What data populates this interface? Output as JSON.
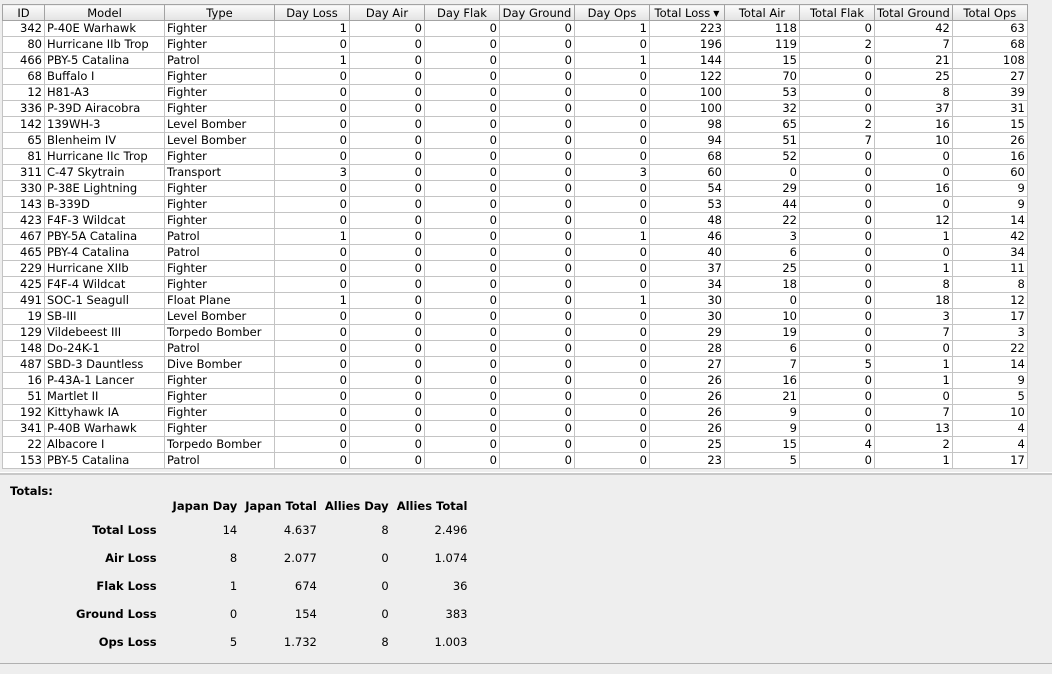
{
  "table": {
    "columns": [
      "ID",
      "Model",
      "Type",
      "Day Loss",
      "Day Air",
      "Day Flak",
      "Day Ground",
      "Day Ops",
      "Total Loss",
      "Total Air",
      "Total Flak",
      "Total Ground",
      "Total Ops"
    ],
    "sort": {
      "column": "Total Loss",
      "direction": "descending",
      "icon": "sort-descending-icon"
    },
    "rows": [
      [
        "342",
        "P-40E Warhawk",
        "Fighter",
        "1",
        "0",
        "0",
        "0",
        "1",
        "223",
        "118",
        "0",
        "42",
        "63"
      ],
      [
        "80",
        "Hurricane IIb Trop",
        "Fighter",
        "0",
        "0",
        "0",
        "0",
        "0",
        "196",
        "119",
        "2",
        "7",
        "68"
      ],
      [
        "466",
        "PBY-5 Catalina",
        "Patrol",
        "1",
        "0",
        "0",
        "0",
        "1",
        "144",
        "15",
        "0",
        "21",
        "108"
      ],
      [
        "68",
        "Buffalo I",
        "Fighter",
        "0",
        "0",
        "0",
        "0",
        "0",
        "122",
        "70",
        "0",
        "25",
        "27"
      ],
      [
        "12",
        "H81-A3",
        "Fighter",
        "0",
        "0",
        "0",
        "0",
        "0",
        "100",
        "53",
        "0",
        "8",
        "39"
      ],
      [
        "336",
        "P-39D Airacobra",
        "Fighter",
        "0",
        "0",
        "0",
        "0",
        "0",
        "100",
        "32",
        "0",
        "37",
        "31"
      ],
      [
        "142",
        "139WH-3",
        "Level Bomber",
        "0",
        "0",
        "0",
        "0",
        "0",
        "98",
        "65",
        "2",
        "16",
        "15"
      ],
      [
        "65",
        "Blenheim IV",
        "Level Bomber",
        "0",
        "0",
        "0",
        "0",
        "0",
        "94",
        "51",
        "7",
        "10",
        "26"
      ],
      [
        "81",
        "Hurricane IIc Trop",
        "Fighter",
        "0",
        "0",
        "0",
        "0",
        "0",
        "68",
        "52",
        "0",
        "0",
        "16"
      ],
      [
        "311",
        "C-47 Skytrain",
        "Transport",
        "3",
        "0",
        "0",
        "0",
        "3",
        "60",
        "0",
        "0",
        "0",
        "60"
      ],
      [
        "330",
        "P-38E Lightning",
        "Fighter",
        "0",
        "0",
        "0",
        "0",
        "0",
        "54",
        "29",
        "0",
        "16",
        "9"
      ],
      [
        "143",
        "B-339D",
        "Fighter",
        "0",
        "0",
        "0",
        "0",
        "0",
        "53",
        "44",
        "0",
        "0",
        "9"
      ],
      [
        "423",
        "F4F-3 Wildcat",
        "Fighter",
        "0",
        "0",
        "0",
        "0",
        "0",
        "48",
        "22",
        "0",
        "12",
        "14"
      ],
      [
        "467",
        "PBY-5A Catalina",
        "Patrol",
        "1",
        "0",
        "0",
        "0",
        "1",
        "46",
        "3",
        "0",
        "1",
        "42"
      ],
      [
        "465",
        "PBY-4 Catalina",
        "Patrol",
        "0",
        "0",
        "0",
        "0",
        "0",
        "40",
        "6",
        "0",
        "0",
        "34"
      ],
      [
        "229",
        "Hurricane XIIb",
        "Fighter",
        "0",
        "0",
        "0",
        "0",
        "0",
        "37",
        "25",
        "0",
        "1",
        "11"
      ],
      [
        "425",
        "F4F-4 Wildcat",
        "Fighter",
        "0",
        "0",
        "0",
        "0",
        "0",
        "34",
        "18",
        "0",
        "8",
        "8"
      ],
      [
        "491",
        "SOC-1 Seagull",
        "Float Plane",
        "1",
        "0",
        "0",
        "0",
        "1",
        "30",
        "0",
        "0",
        "18",
        "12"
      ],
      [
        "19",
        "SB-III",
        "Level Bomber",
        "0",
        "0",
        "0",
        "0",
        "0",
        "30",
        "10",
        "0",
        "3",
        "17"
      ],
      [
        "129",
        "Vildebeest III",
        "Torpedo Bomber",
        "0",
        "0",
        "0",
        "0",
        "0",
        "29",
        "19",
        "0",
        "7",
        "3"
      ],
      [
        "148",
        "Do-24K-1",
        "Patrol",
        "0",
        "0",
        "0",
        "0",
        "0",
        "28",
        "6",
        "0",
        "0",
        "22"
      ],
      [
        "487",
        "SBD-3 Dauntless",
        "Dive Bomber",
        "0",
        "0",
        "0",
        "0",
        "0",
        "27",
        "7",
        "5",
        "1",
        "14"
      ],
      [
        "16",
        "P-43A-1 Lancer",
        "Fighter",
        "0",
        "0",
        "0",
        "0",
        "0",
        "26",
        "16",
        "0",
        "1",
        "9"
      ],
      [
        "51",
        "Martlet II",
        "Fighter",
        "0",
        "0",
        "0",
        "0",
        "0",
        "26",
        "21",
        "0",
        "0",
        "5"
      ],
      [
        "192",
        "Kittyhawk IA",
        "Fighter",
        "0",
        "0",
        "0",
        "0",
        "0",
        "26",
        "9",
        "0",
        "7",
        "10"
      ],
      [
        "341",
        "P-40B Warhawk",
        "Fighter",
        "0",
        "0",
        "0",
        "0",
        "0",
        "26",
        "9",
        "0",
        "13",
        "4"
      ],
      [
        "22",
        "Albacore I",
        "Torpedo Bomber",
        "0",
        "0",
        "0",
        "0",
        "0",
        "25",
        "15",
        "4",
        "2",
        "4"
      ],
      [
        "153",
        "PBY-5 Catalina",
        "Patrol",
        "0",
        "0",
        "0",
        "0",
        "0",
        "23",
        "5",
        "0",
        "1",
        "17"
      ]
    ]
  },
  "totals": {
    "heading": "Totals:",
    "columns": [
      "Japan Day",
      "Japan Total",
      "Allies Day",
      "Allies Total"
    ],
    "rows": [
      {
        "label": "Total Loss",
        "values": [
          "14",
          "4.637",
          "8",
          "2.496"
        ]
      },
      {
        "label": "Air Loss",
        "values": [
          "8",
          "2.077",
          "0",
          "1.074"
        ]
      },
      {
        "label": "Flak Loss",
        "values": [
          "1",
          "674",
          "0",
          "36"
        ]
      },
      {
        "label": "Ground Loss",
        "values": [
          "0",
          "154",
          "0",
          "383"
        ]
      },
      {
        "label": "Ops Loss",
        "values": [
          "5",
          "1.732",
          "8",
          "1.003"
        ]
      }
    ]
  }
}
